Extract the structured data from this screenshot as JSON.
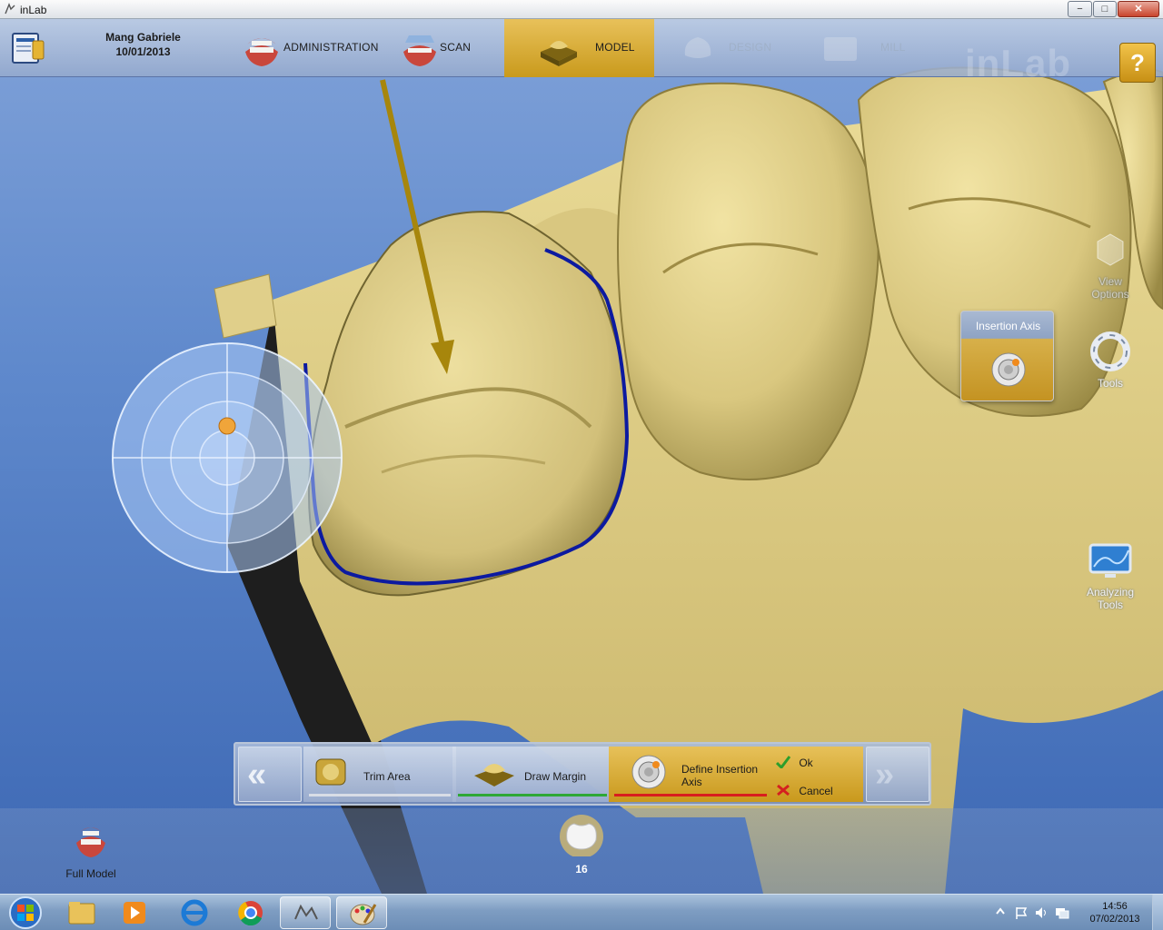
{
  "window": {
    "title": "inLab",
    "min_glyph": "−",
    "max_glyph": "□",
    "close_glyph": "✕"
  },
  "header": {
    "patient_name": "Mang Gabriele",
    "patient_date": "10/01/2013",
    "steps": [
      {
        "label": "ADMINISTRATION",
        "state": "enabled"
      },
      {
        "label": "SCAN",
        "state": "enabled"
      },
      {
        "label": "MODEL",
        "state": "active"
      },
      {
        "label": "DESIGN",
        "state": "disabled"
      },
      {
        "label": "MILL",
        "state": "disabled"
      }
    ],
    "logo": "inLab",
    "help_glyph": "?"
  },
  "right_panel": {
    "view_options": "View\nOptions",
    "insertion_axis_title": "Insertion Axis",
    "tools": "Tools",
    "analyzing_tools": "Analyzing\nTools"
  },
  "wizard": {
    "prev_glyph": "«",
    "next_glyph": "»",
    "steps": [
      {
        "label": "Trim Area",
        "status_color": "#d8dde6"
      },
      {
        "label": "Draw Margin",
        "status_color": "#2ea836"
      },
      {
        "label": "Define Insertion\nAxis",
        "status_color": "#d81e1e"
      }
    ],
    "ok_label": "Ok",
    "cancel_label": "Cancel"
  },
  "bottom": {
    "full_model_label": "Full Model",
    "tooth_number": "16"
  },
  "taskbar": {
    "clock_time": "14:56",
    "clock_date": "07/02/2013",
    "apps": [
      "file-explorer",
      "media-player",
      "internet-explorer",
      "chrome",
      "inlab",
      "paint"
    ]
  },
  "colors": {
    "accent_gold": "#d7ae3c",
    "model_yellow": "#e5d68f",
    "margin_line": "#0c1aa0",
    "insertion_arrow": "#a7860c"
  }
}
